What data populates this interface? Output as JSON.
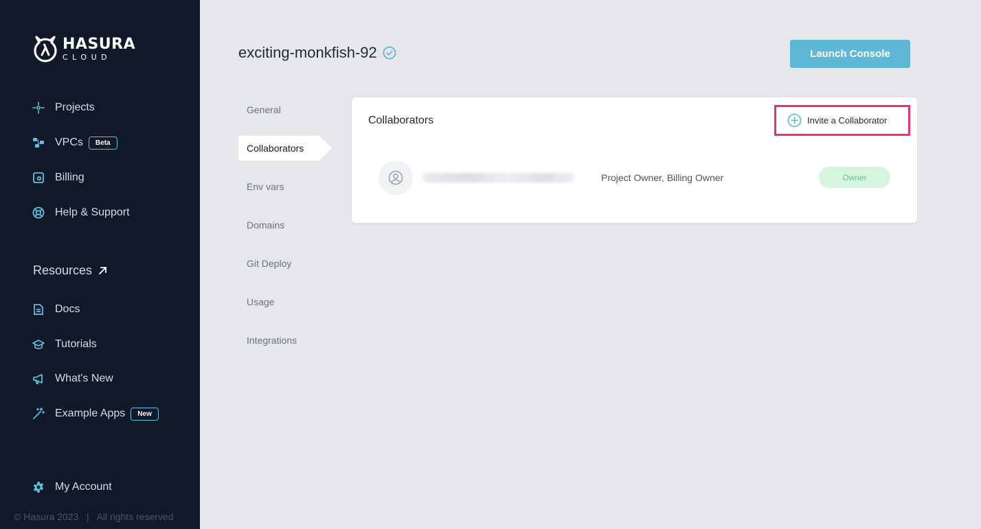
{
  "brand": {
    "line1": "HASURA",
    "line2": "CLOUD"
  },
  "sidebar": {
    "items": [
      {
        "label": "Projects",
        "icon": "projects-icon"
      },
      {
        "label": "VPCs",
        "icon": "vpc-icon",
        "tag": "Beta"
      },
      {
        "label": "Billing",
        "icon": "billing-icon"
      },
      {
        "label": "Help & Support",
        "icon": "lifebuoy-icon"
      }
    ],
    "resources_label": "Resources",
    "resources": [
      {
        "label": "Docs",
        "icon": "document-icon"
      },
      {
        "label": "Tutorials",
        "icon": "graduation-cap-icon"
      },
      {
        "label": "What's New",
        "icon": "megaphone-icon"
      },
      {
        "label": "Example Apps",
        "icon": "magic-wand-icon",
        "tag": "New"
      }
    ],
    "account_label": "My Account",
    "footer": "© Hasura 2023   |   All rights reserved"
  },
  "project": {
    "name": "exciting-monkfish-92"
  },
  "launch_label": "Launch Console",
  "subnav": [
    "General",
    "Collaborators",
    "Env vars",
    "Domains",
    "Git Deploy",
    "Usage",
    "Integrations"
  ],
  "subnav_active": "Collaborators",
  "collaborators": {
    "title": "Collaborators",
    "invite_label": "Invite a Collaborator",
    "rows": [
      {
        "roles": "Project Owner, Billing Owner",
        "badge": "Owner"
      }
    ]
  },
  "colors": {
    "sidebar_bg": "#111827",
    "accent": "#5fb7d6",
    "highlight": "#e8316f",
    "badge_bg": "#d6f5df",
    "badge_text": "#5fc98a"
  }
}
